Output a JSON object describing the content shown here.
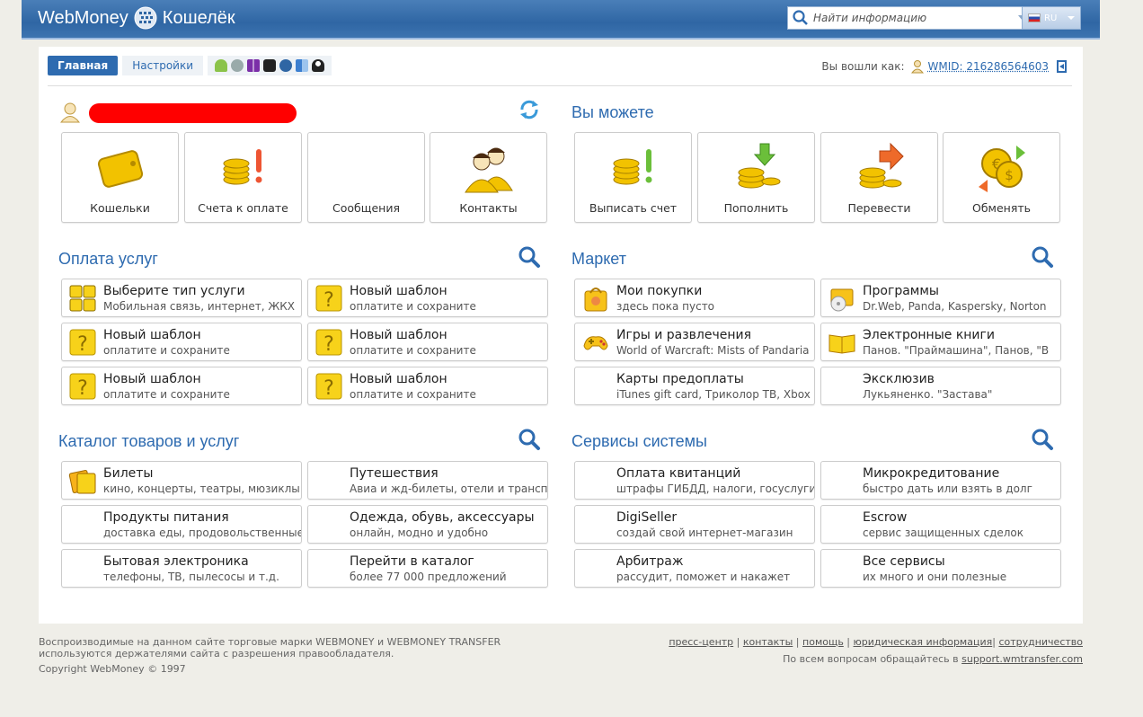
{
  "header": {
    "logo_left": "WebMoney",
    "logo_right": "Кошелёк",
    "search_placeholder": "Найти информацию",
    "lang": "RU"
  },
  "tabs": [
    {
      "label": "Главная"
    },
    {
      "label": "Настройки"
    }
  ],
  "platforms": [
    "android-icon",
    "apple-icon",
    "windows-icon",
    "blackberry-icon",
    "web-icon",
    "mac-icon",
    "linux-icon"
  ],
  "login": {
    "label": "Вы вошли как:",
    "wmid": "WMID: 216286564603"
  },
  "profile": {
    "tiles": [
      {
        "label": "Кошельки",
        "icon": "wallet-icon"
      },
      {
        "label": "Счета к оплате",
        "icon": "invoice-coins-icon"
      },
      {
        "label": "Сообщения",
        "icon": "messages-icon"
      },
      {
        "label": "Контакты",
        "icon": "contacts-icon"
      }
    ]
  },
  "you_can": {
    "title": "Вы можете",
    "tiles": [
      {
        "label": "Выписать счет",
        "icon": "coins-exclamation-icon"
      },
      {
        "label": "Пополнить",
        "icon": "coins-down-arrow-icon"
      },
      {
        "label": "Перевести",
        "icon": "coins-right-arrow-icon"
      },
      {
        "label": "Обменять",
        "icon": "exchange-coins-icon"
      }
    ]
  },
  "services": {
    "title": "Оплата услуг",
    "items": [
      {
        "title": "Выберите тип услуги",
        "sub": "Мобильная связь, интернет, ЖКХ"
      },
      {
        "title": "Новый шаблон",
        "sub": "оплатите и сохраните"
      },
      {
        "title": "Новый шаблон",
        "sub": "оплатите и сохраните"
      },
      {
        "title": "Новый шаблон",
        "sub": "оплатите и сохраните"
      },
      {
        "title": "Новый шаблон",
        "sub": "оплатите и сохраните"
      },
      {
        "title": "Новый шаблон",
        "sub": "оплатите и сохраните"
      }
    ]
  },
  "market": {
    "title": "Маркет",
    "items": [
      {
        "title": "Мои покупки",
        "sub": "здесь пока пусто"
      },
      {
        "title": "Программы",
        "sub": "Dr.Web, Panda, Kaspersky, Norton"
      },
      {
        "title": "Игры и развлечения",
        "sub": "World of Warcraft: Mists of Pandaria"
      },
      {
        "title": "Электронные книги",
        "sub": "Панов. \"Праймашина\", Панов, \"В"
      },
      {
        "title": "Карты предоплаты",
        "sub": "iTunes gift card, Триколор ТВ, Xbox"
      },
      {
        "title": "Эксклюзив",
        "sub": "Лукьяненко. \"Застава\""
      }
    ]
  },
  "catalog": {
    "title": "Каталог товаров и услуг",
    "items": [
      {
        "title": "Билеты",
        "sub": "кино, концерты, театры, мюзиклы"
      },
      {
        "title": "Путешествия",
        "sub": "Авиа и жд-билеты, отели и транспорт"
      },
      {
        "title": "Продукты питания",
        "sub": "доставка еды, продовольственные"
      },
      {
        "title": "Одежда, обувь, аксессуары",
        "sub": "онлайн, модно и удобно"
      },
      {
        "title": "Бытовая электроника",
        "sub": "телефоны, ТВ, пылесосы и т.д."
      },
      {
        "title": "Перейти в каталог",
        "sub": "более 77 000 предложений"
      }
    ]
  },
  "system": {
    "title": "Сервисы системы",
    "items": [
      {
        "title": "Оплата квитанций",
        "sub": "штрафы ГИБДД, налоги, госуслуги"
      },
      {
        "title": "Микрокредитование",
        "sub": "быстро дать или взять в долг"
      },
      {
        "title": "DigiSeller",
        "sub": "создай свой интернет-магазин"
      },
      {
        "title": "Escrow",
        "sub": "сервис защищенных сделок"
      },
      {
        "title": "Арбитраж",
        "sub": "рассудит, поможет и накажет"
      },
      {
        "title": "Все сервисы",
        "sub": "их много и они полезные"
      }
    ]
  },
  "footer": {
    "line1": "Воспроизводимые на данном сайте торговые марки WEBMONEY и WEBMONEY TRANSFER",
    "line2": "используются держателями сайта с разрешения правообладателя.",
    "copyright": "Copyright WebMoney © 1997",
    "links": [
      "пресс-центр",
      "контакты",
      "помощь",
      "юридическая информация",
      "сотрудничество"
    ],
    "support_label": "По всем вопросам обращайтесь в",
    "support_link": "support.wmtransfer.com"
  }
}
